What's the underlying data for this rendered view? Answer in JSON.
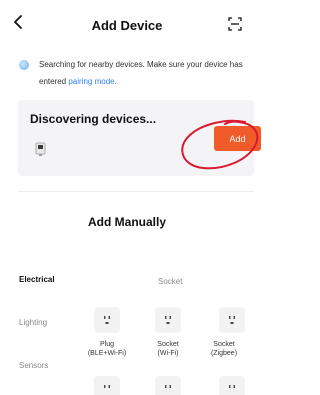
{
  "header": {
    "title": "Add Device"
  },
  "search": {
    "text": "Searching for nearby devices. Make sure your device has entered ",
    "link": "pairing mode",
    "end": "."
  },
  "discover": {
    "title": "Discovering devices...",
    "add_label": "Add"
  },
  "manual": {
    "title": "Add Manually"
  },
  "categories": [
    {
      "label": "Electrical",
      "active": true
    },
    {
      "label": "Lighting",
      "active": false
    },
    {
      "label": "Sensors",
      "active": false
    }
  ],
  "subcategory": "Socket",
  "devices": [
    {
      "line1": "Plug",
      "line2": "(BLE+Wi-Fi)"
    },
    {
      "line1": "Socket",
      "line2": "(Wi-Fi)"
    },
    {
      "line1": "Socket",
      "line2": "(Zigbee)"
    }
  ],
  "colors": {
    "accent": "#f15a29",
    "link": "#2f83f0",
    "highlight": "#d8192f"
  }
}
